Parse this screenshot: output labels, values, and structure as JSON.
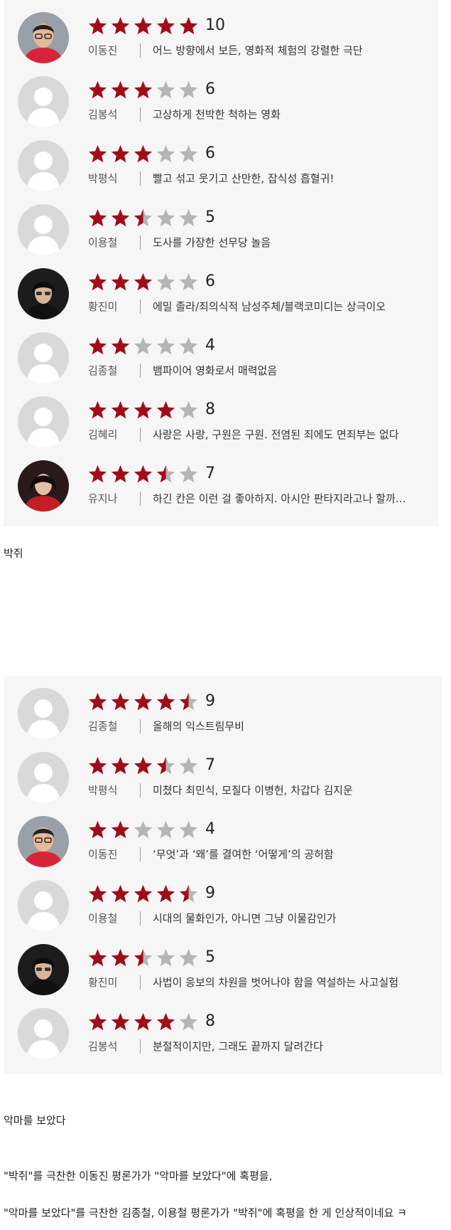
{
  "colors": {
    "star_on": "#a00d1a",
    "star_off": "#b5b5b5",
    "panel_bg": "#f6f6f6"
  },
  "panel1": {
    "reviews": [
      {
        "name": "이동진",
        "score": "10",
        "rating": 5,
        "comment": "어느 방향에서 보든, 영화적 체험의 강렬한 극단",
        "avatar": "photo-man-glasses"
      },
      {
        "name": "김봉석",
        "score": "6",
        "rating": 3,
        "comment": "고상하게 천박한 척하는 영화",
        "avatar": "default"
      },
      {
        "name": "박평식",
        "score": "6",
        "rating": 3,
        "comment": "빨고 섞고 웃기고 산만한, 잡식성 흡혈귀!",
        "avatar": "default"
      },
      {
        "name": "이용철",
        "score": "5",
        "rating": 2.5,
        "comment": "도사를 가장한 선무당 놀음",
        "avatar": "default"
      },
      {
        "name": "황진미",
        "score": "6",
        "rating": 3,
        "comment": "에밀 졸라/죄의식적 남성주체/블랙코미디는 상극이오",
        "avatar": "photo-woman-dark"
      },
      {
        "name": "김종철",
        "score": "4",
        "rating": 2,
        "comment": "뱀파이어 영화로서 매력없음",
        "avatar": "default"
      },
      {
        "name": "김혜리",
        "score": "8",
        "rating": 4,
        "comment": "사랑은 사랑, 구원은 구원. 전염된 죄에도 면죄부는 없다",
        "avatar": "default"
      },
      {
        "name": "유지나",
        "score": "7",
        "rating": 3.5,
        "comment": "하긴 칸은 이런 걸 좋아하지. 아시안 판타지라고나 할까…",
        "avatar": "photo-woman-red"
      }
    ]
  },
  "caption1": "박쥐",
  "panel2": {
    "reviews": [
      {
        "name": "김종철",
        "score": "9",
        "rating": 4.5,
        "comment": "올해의 익스트림무비",
        "avatar": "default"
      },
      {
        "name": "박평식",
        "score": "7",
        "rating": 3.5,
        "comment": "미쳤다 최민식, 모질다 이병헌, 차갑다 김지운",
        "avatar": "default"
      },
      {
        "name": "이동진",
        "score": "4",
        "rating": 2,
        "comment": "‘무엇’과 ‘왜’를 결여한 ‘어떻게’의 공허함",
        "avatar": "photo-man-glasses"
      },
      {
        "name": "이용철",
        "score": "9",
        "rating": 4.5,
        "comment": "시대의 물화인가, 아니면 그냥 이물감인가",
        "avatar": "default"
      },
      {
        "name": "황진미",
        "score": "5",
        "rating": 2.5,
        "comment": "사법이 응보의 차원을 벗어나야 함을 역설하는 사고실험",
        "avatar": "photo-woman-dark"
      },
      {
        "name": "김봉석",
        "score": "8",
        "rating": 4,
        "comment": "분절적이지만, 그래도 끝까지 달려간다",
        "avatar": "default"
      }
    ]
  },
  "caption2": "악마를 보았다",
  "caption3": "\"박쥐\"를 극찬한 이동진 평론가가 \"악마를 보았다\"에 혹평을,",
  "caption4": "\"악마를 보았다\"를 극찬한 김종철, 이용철 평론가가 \"박쥐\"에 혹평을 한 게 인상적이네요 ㅋ"
}
